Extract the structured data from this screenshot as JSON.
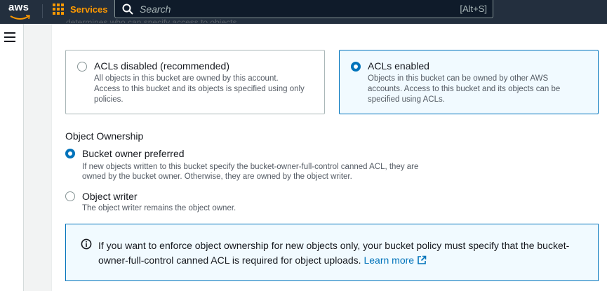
{
  "topbar": {
    "logo_text": "aws",
    "services_label": "Services",
    "search_placeholder": "Search",
    "search_shortcut": "[Alt+S]"
  },
  "page": {
    "clipped_text": "determines who can specify access to objects.",
    "acl_options": [
      {
        "title": "ACLs disabled (recommended)",
        "description": "All objects in this bucket are owned by this account. Access to this bucket and its objects is specified using only policies.",
        "selected": false
      },
      {
        "title": "ACLs enabled",
        "description": "Objects in this bucket can be owned by other AWS accounts. Access to this bucket and its objects can be specified using ACLs.",
        "selected": true
      }
    ],
    "ownership": {
      "label": "Object Ownership",
      "options": [
        {
          "title": "Bucket owner preferred",
          "description_line1": "If new objects written to this bucket specify the bucket-owner-full-control canned ACL, they are",
          "description_line2": "owned by the bucket owner. Otherwise, they are owned by the object writer.",
          "selected": true
        },
        {
          "title": "Object writer",
          "description_line1": "The object writer remains the object owner.",
          "selected": false
        }
      ]
    },
    "info": {
      "text": "If you want to enforce object ownership for new objects only, your bucket policy must specify that the bucket-owner-full-control canned ACL is required for object uploads.",
      "link_text": "Learn more"
    }
  },
  "colors": {
    "topbar_bg": "#232f3e",
    "accent_orange": "#ff9900",
    "selection_blue": "#0073bb",
    "selected_bg": "#f1faff"
  },
  "icons": [
    "grid-icon",
    "search-icon",
    "hamburger-menu-icon",
    "info-icon",
    "external-link-icon"
  ]
}
